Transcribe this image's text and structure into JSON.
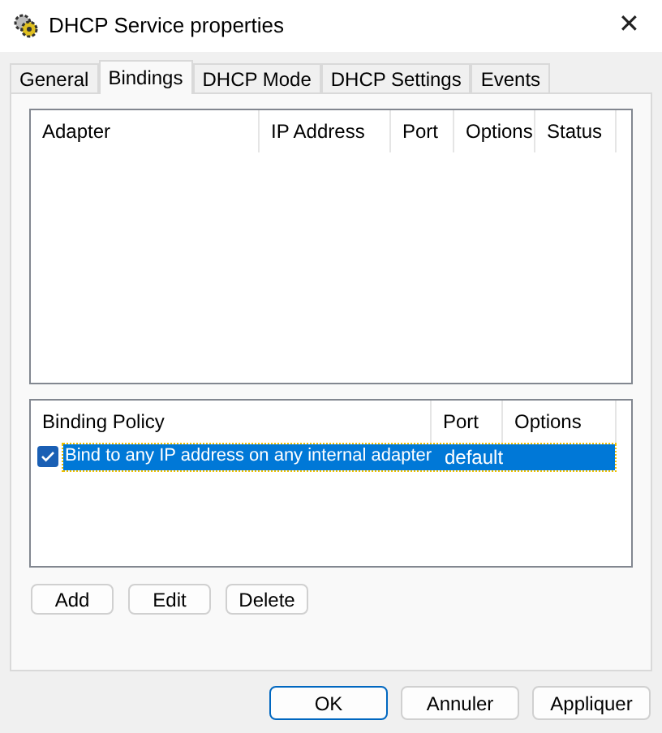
{
  "window": {
    "title": "DHCP Service properties",
    "close": "✕"
  },
  "tabs": [
    {
      "label": "General",
      "selected": false
    },
    {
      "label": "Bindings",
      "selected": true
    },
    {
      "label": "DHCP Mode",
      "selected": false
    },
    {
      "label": "DHCP Settings",
      "selected": false
    },
    {
      "label": "Events",
      "selected": false
    }
  ],
  "adapters_table": {
    "columns": [
      "Adapter",
      "IP Address",
      "Port",
      "Options",
      "Status"
    ]
  },
  "policy_table": {
    "columns": [
      "Binding Policy",
      "Port",
      "Options"
    ],
    "rows": [
      {
        "policy": "Bind to any IP address on any internal adapter",
        "port": "default",
        "options": "",
        "checked": true,
        "selected": true
      }
    ]
  },
  "list_buttons": [
    "Add",
    "Edit",
    "Delete"
  ],
  "dialog_buttons": [
    {
      "label": "OK",
      "default": true
    },
    {
      "label": "Annuler",
      "default": false
    },
    {
      "label": "Appliquer",
      "default": false
    }
  ]
}
